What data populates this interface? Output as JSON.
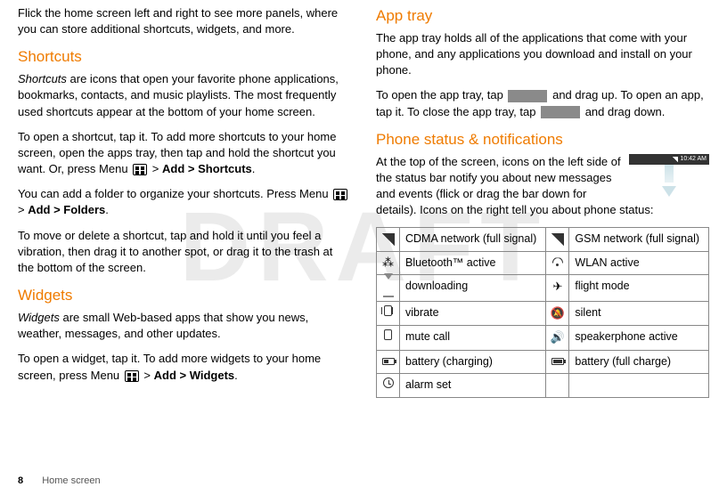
{
  "watermark": "DRAFT",
  "left": {
    "intro": "Flick the home screen left and right to see more panels, where you can store additional shortcuts, widgets, and more.",
    "shortcuts": {
      "heading": "Shortcuts",
      "p1_italic": "Shortcuts",
      "p1_rest": " are icons that open your favorite phone applications, bookmarks, contacts, and music playlists. The most frequently used shortcuts appear at the bottom of your home screen.",
      "p2a": "To open a shortcut, tap it. To add more shortcuts to your home screen, open the apps tray, then tap and hold the shortcut you want. Or, press Menu ",
      "p2b": " > ",
      "p2c": "Add > Shortcuts",
      "p2d": ".",
      "p3a": "You can add a folder to organize your shortcuts. Press Menu ",
      "p3b": " > ",
      "p3c": "Add > Folders",
      "p3d": ".",
      "p4": "To move or delete a shortcut, tap and hold it until you feel a vibration, then drag it to another spot, or drag it to the trash at the bottom of the screen."
    },
    "widgets": {
      "heading": "Widgets",
      "p1_italic": "Widgets",
      "p1_rest": " are small Web-based apps that show you news, weather, messages, and other updates.",
      "p2a": "To open a widget, tap it. To add more widgets to your home screen, press Menu ",
      "p2b": " > ",
      "p2c": "Add > Widgets",
      "p2d": "."
    }
  },
  "right": {
    "apptray": {
      "heading": "App tray",
      "p1": "The app tray holds all of the applications that come with your phone, and any applications you download and install on your phone.",
      "p2a": "To open the app tray, tap ",
      "p2b": " and drag up. To open an app, tap it. To close the app tray, tap ",
      "p2c": " and drag down."
    },
    "status": {
      "heading": "Phone status & notifications",
      "intro": "At the top of the screen, icons on the left side of the status bar notify you about new messages and events (flick or drag the bar down for details). Icons on the right tell you about phone status:",
      "clock": "10:42 AM",
      "table": [
        {
          "l_icon": "signal",
          "l_text": "CDMA network (full signal)",
          "r_icon": "signal",
          "r_text": "GSM network (full signal)"
        },
        {
          "l_icon": "bluetooth",
          "l_text": "Bluetooth™ active",
          "r_icon": "wlan",
          "r_text": "WLAN active"
        },
        {
          "l_icon": "download",
          "l_text": "downloading",
          "r_icon": "plane",
          "r_text": "flight mode"
        },
        {
          "l_icon": "vibrate",
          "l_text": "vibrate",
          "r_icon": "silent",
          "r_text": "silent"
        },
        {
          "l_icon": "mute",
          "l_text": "mute call",
          "r_icon": "speaker",
          "r_text": "speakerphone active"
        },
        {
          "l_icon": "bat-chg",
          "l_text": "battery (charging)",
          "r_icon": "bat-full",
          "r_text": "battery (full charge)"
        },
        {
          "l_icon": "alarm",
          "l_text": "alarm set",
          "r_icon": "",
          "r_text": ""
        }
      ]
    }
  },
  "footer": {
    "page": "8",
    "section": "Home screen"
  }
}
